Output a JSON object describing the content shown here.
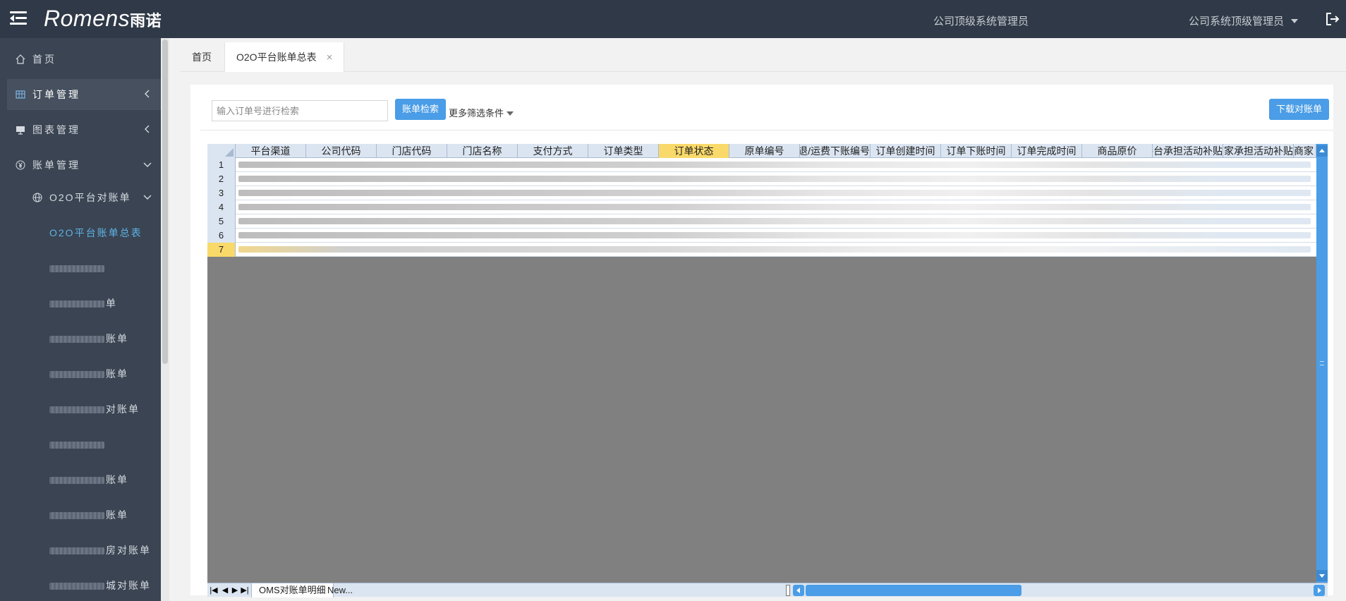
{
  "header": {
    "logo_text": "Romens",
    "logo_cn": "雨诺",
    "company_label": "公司顶级系统管理员",
    "user_label": "公司系统顶级管理员",
    "icons": {
      "menu": "menu-toggle-icon",
      "logout": "logout-icon"
    }
  },
  "sidebar": {
    "items": [
      {
        "label": "首页",
        "icon": "home-icon"
      },
      {
        "label": "订单管理",
        "icon": "grid-icon",
        "state": "collapsed"
      },
      {
        "label": "图表管理",
        "icon": "chart-icon",
        "state": "collapsed"
      },
      {
        "label": "账单管理",
        "icon": "yen-icon",
        "state": "expanded"
      }
    ],
    "sub_group": {
      "label": "O2O平台对账单",
      "icon": "globe-icon",
      "state": "expanded"
    },
    "leaves": [
      {
        "label": "O2O平台账单总表",
        "current": true
      },
      {
        "suffix": "",
        "redacted": true
      },
      {
        "suffix": "单",
        "redacted": true
      },
      {
        "suffix": "账单",
        "redacted": true
      },
      {
        "suffix": "账单",
        "redacted": true
      },
      {
        "suffix": "对账单",
        "redacted": true
      },
      {
        "suffix": "",
        "redacted": true
      },
      {
        "suffix": "账单",
        "redacted": true
      },
      {
        "suffix": "账单",
        "redacted": true
      },
      {
        "suffix": "房对账单",
        "redacted": true
      },
      {
        "suffix": "城对账单",
        "redacted": true
      }
    ]
  },
  "tabs": [
    {
      "label": "首页",
      "active": false
    },
    {
      "label": "O2O平台账单总表",
      "active": true,
      "close": "×"
    }
  ],
  "toolbar": {
    "search_placeholder": "输入订单号进行检索",
    "search_button": "账单检索",
    "filter_label": "更多筛选条件",
    "download_button": "下载对账单"
  },
  "sheet": {
    "columns": [
      "平台渠道",
      "公司代码",
      "门店代码",
      "门店名称",
      "支付方式",
      "订单类型",
      "订单状态",
      "原单编号",
      "退/运费下账编号",
      "订单创建时间",
      "订单下账时间",
      "订单完成时间",
      "商品原价",
      "平台承担活动补贴",
      "商家承担活动补贴",
      "商家"
    ],
    "selected_column": "订单状态",
    "row_numbers": [
      "1",
      "2",
      "3",
      "4",
      "5",
      "6",
      "7"
    ],
    "selected_row": "7",
    "sheet_tabs": [
      "OMS对账单明细",
      "New..."
    ],
    "colors": {
      "header_bg": "#dbe5f1",
      "selection": "#f9d96a",
      "scroll": "#4a9de6",
      "empty_area": "#808080"
    }
  },
  "colors": {
    "topbar": "#2f3947",
    "sidebar": "#3a4452",
    "accent": "#4a9de6",
    "current_link": "#5fb3e6"
  }
}
